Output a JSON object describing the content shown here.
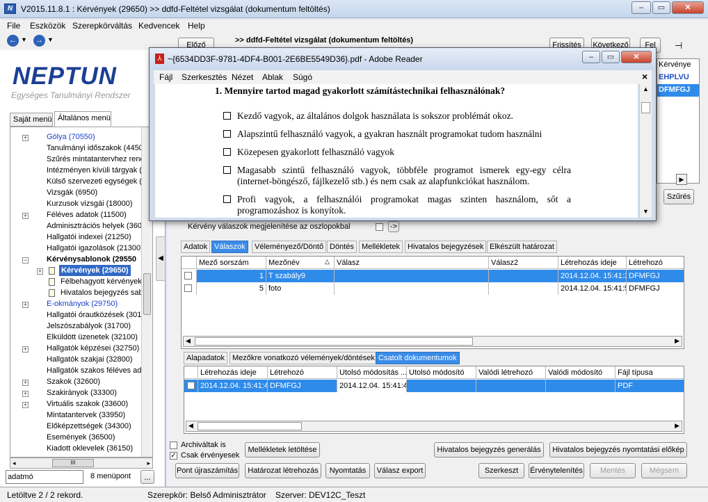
{
  "window": {
    "title": "V2015.11.8.1 : Kérvények (29650)  >> ddfd-Feltétel vizsgálat  (dokumentum feltöltés)",
    "app_icon": "N"
  },
  "menu": [
    "File",
    "Eszközök",
    "Szerepkörváltás",
    "Kedvencek",
    "Help"
  ],
  "left": {
    "logo": "NEPTUN",
    "logo_sub": "Egységes Tanulmányi Rendszer",
    "tabs": [
      "Saját menü",
      "Általános menü"
    ],
    "tree": [
      "Gólya (70550)",
      "Tanulmányi időszakok (4450)",
      "Szűrés mintatantervhez rende",
      "Intézményen kívüli tárgyak (4",
      "Külső szervezeti egységek (6",
      "Vizsgák (6950)",
      "Kurzusok vizsgái (18000)",
      "Féléves adatok (11500)",
      "Adminisztrációs helyek (3600)",
      "Hallgatói indexei (21250)",
      "Hallgatói igazolások (21300)",
      "Kérvénysablonok (29550",
      "Kérvények (29650)",
      "Félbehagyott kérvények (",
      "Hivatalos bejegyzés sablo",
      "E-okmányok (29750)",
      "Hallgatói órautközések (3010",
      "Jelszószabályok (31700)",
      "Elküldött üzenetek (32100)",
      "Hallgatók képzései (32750)",
      "Hallgatók szakjai (32800)",
      "Hallgatók szakos féléves ada",
      "Szakok (32600)",
      "Szakirányok (33300)",
      "Virtuális szakok (33600)",
      "Mintatantervek (33950)",
      "Előképzettségek (34300)",
      "Események (36500)",
      "Kiadott oklevelek (36150)"
    ],
    "search_value": "adatmó",
    "menu_count": "8 menüpont",
    "more_btn": "...",
    "hscroll_mark": "III"
  },
  "status": {
    "left": "Letöltve 2 / 2 rekord.",
    "role": "Szerepkör: Belső Adminisztrátor",
    "server": "Szerver: DEV12C_Teszt"
  },
  "right": {
    "prev_btn": "Előző",
    "header": ">> ddfd-Feltétel vizsgálat  (dokumentum feltöltés)",
    "refresh_btn": "Frissítés",
    "next_btn": "Következő",
    "up_btn": "Fel",
    "pin": "⊣",
    "kerv_col": "Kérvénye",
    "kerv_vals": [
      "EHPLVU",
      "DFMFGJ"
    ],
    "filter_btn": "Szűrés",
    "answers_label": "Kérvény válaszok megjelenítése az oszlopokbal",
    "arrow_btn": "->",
    "tabs1": [
      "Adatok",
      "Válaszok",
      "Véleményező/Döntő",
      "Döntés",
      "Mellékletek",
      "Hivatalos bejegyzések",
      "Elkészült határozat"
    ],
    "grid1": {
      "headers": [
        "Mező sorszám",
        "Mezőnév",
        "Válasz",
        "Válasz2",
        "Létrehozás ideje",
        "Létrehozó"
      ],
      "rows": [
        [
          "1",
          "T szabály9",
          "",
          "",
          "2014.12.04. 15:41:3",
          "DFMFGJ"
        ],
        [
          "5",
          "foto",
          "",
          "",
          "2014.12.04. 15:41:5",
          "DFMFGJ"
        ]
      ]
    },
    "tabs2": [
      "Alapadatok",
      "Mezőkre vonatkozó vélemények/döntések",
      "Csatolt dokumentumok"
    ],
    "grid2": {
      "headers": [
        "Létrehozás ideje",
        "Létrehozó",
        "Utolsó módosítás ...",
        "Utolsó módosító",
        "Valódi létrehozó",
        "Valódi módosító",
        "Fájl típusa"
      ],
      "rows": [
        [
          "2014.12.04. 15:41:4",
          "DFMFGJ",
          "2014.12.04. 15:41:4",
          "",
          "",
          "",
          "PDF"
        ]
      ]
    },
    "archived_label": "Archiváltak is",
    "valid_label": "Csak érvényesek",
    "buttons_row1": [
      "Mellékletek letöltése",
      "Hivatalos bejegyzés generálás",
      "Hivatalos bejegyzés nyomtatási előkép"
    ],
    "buttons_row2": [
      "Pont újraszámítás",
      "Határozat létrehozás",
      "Nyomtatás",
      "Válasz export",
      "Szerkeszt",
      "Érvénytelenítés",
      "Mentés",
      "Mégsem"
    ]
  },
  "pdf": {
    "title": "~{6534DD3F-9781-4DF4-B001-2E6BE5549D36}.pdf - Adobe Reader",
    "menu": [
      "Fájl",
      "Szerkesztés",
      "Nézet",
      "Ablak",
      "Súgó"
    ],
    "close_x": "×",
    "question": "1.  Mennyire tartod magad gyakorlott számítástechnikai felhasználónak?",
    "options": [
      "Kezdő vagyok, az általános dolgok használata is sokszor problémát okoz.",
      "Alapszintű felhasználó vagyok, a gyakran használt programokat tudom használni",
      "Közepesen gyakorlott felhasználó vagyok",
      "Magasabb szintű felhasználó vagyok, többféle programot ismerek egy-egy célra (internet-böngésző, fájlkezelő stb.) és nem csak az alapfunkciókat használom.",
      "Profi vagyok, a felhasználói programokat magas szinten használom, sőt a programozáshoz is konyítok."
    ]
  },
  "colors": {
    "selection": "#316ac5",
    "tab_active": "#3b8ce8",
    "logo": "#1c3f94",
    "tree_link": "#1a3ec8"
  }
}
